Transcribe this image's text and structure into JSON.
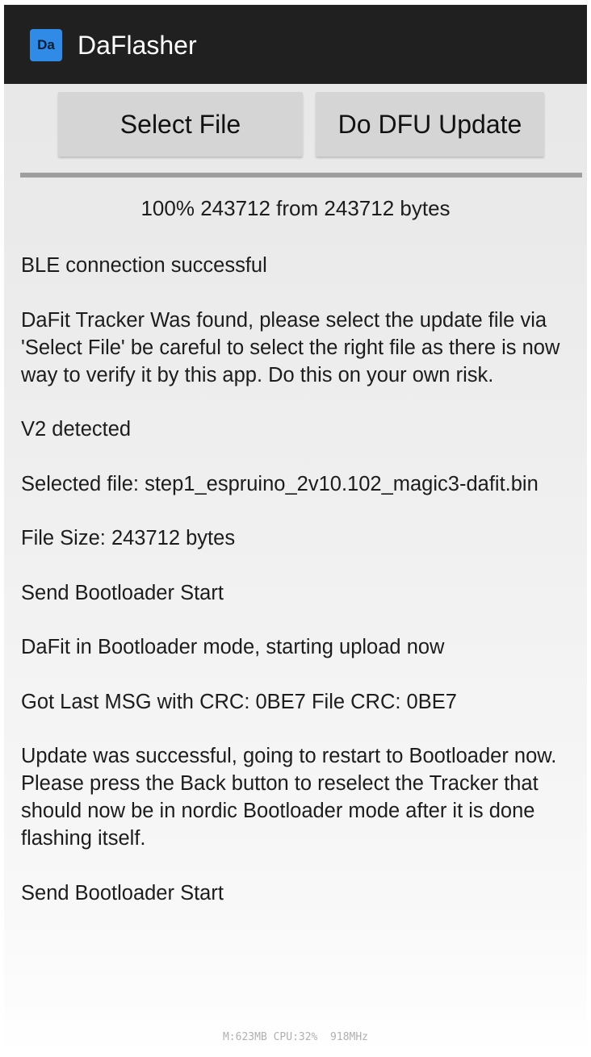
{
  "app": {
    "icon_label": "Da",
    "title": "DaFlasher"
  },
  "toolbar": {
    "select_file_label": "Select File",
    "dfu_update_label": "Do DFU Update"
  },
  "progress": {
    "percent": 100,
    "text": "100% 243712 from 243712 bytes"
  },
  "log": [
    "BLE connection successful",
    "DaFit Tracker Was found, please select the update file via 'Select File' be careful to select the right file as there is now way to verify it by this app. Do this on your own risk.",
    "V2 detected",
    "Selected file: step1_espruino_2v10.102_magic3-dafit.bin",
    "File Size: 243712 bytes",
    "Send Bootloader Start",
    "DaFit in Bootloader mode, starting upload now",
    "Got Last MSG with CRC: 0BE7 File CRC: 0BE7",
    "Update was successful, going to restart to Bootloader now.\nPlease press the Back button to reselect the Tracker that should now be in nordic Bootloader mode after it is done flashing itself.",
    "Send Bootloader Start"
  ],
  "status_footer": "M:623MB CPU:32%  918MHz",
  "colors": {
    "action_bar": "#202020",
    "app_icon": "#2f8be6",
    "button_bg": "#d5d5d5",
    "progress_track": "#b3b3b3"
  }
}
